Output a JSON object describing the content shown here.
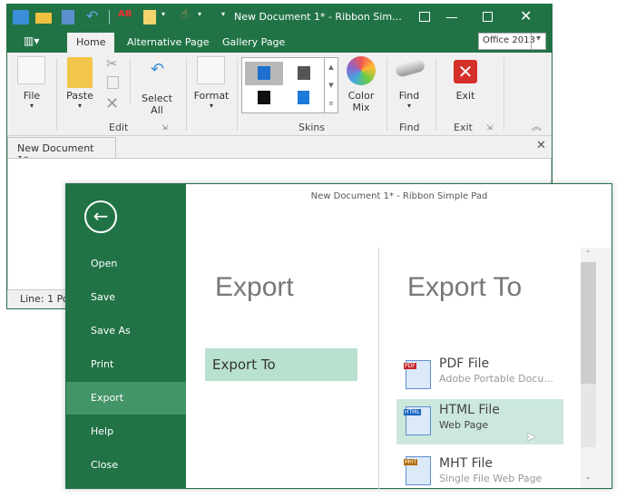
{
  "window": {
    "title": "New Document 1* - Ribbon Simple Pad",
    "title_short": "New Document 1* - Ribbon Sim…"
  },
  "tabs": [
    {
      "label": "Home",
      "active": true
    },
    {
      "label": "Alternative Page"
    },
    {
      "label": "Gallery Page"
    }
  ],
  "skin_select": {
    "value": "Office 2013"
  },
  "ribbon": {
    "file": "File",
    "paste": "Paste",
    "select_all": "Select All",
    "format": "Format",
    "color_mix_1": "Color",
    "color_mix_2": "Mix",
    "find": "Find",
    "exit": "Exit",
    "groups": {
      "edit": "Edit",
      "skins": "Skins",
      "find": "Find",
      "exit": "Exit"
    }
  },
  "document": {
    "tab": "New Document 1*",
    "status": "Line: 1  Po"
  },
  "backstage": {
    "title": "New Document 1* - Ribbon Simple Pad",
    "menu": [
      "Open",
      "Save",
      "Save As",
      "Print",
      "Export",
      "Help",
      "Close"
    ],
    "selected": "Export",
    "heading": "Export",
    "export_to_button": "Export To",
    "right_heading": "Export To",
    "items": [
      {
        "title": "PDF  File",
        "subtitle": "Adobe Portable Docu...",
        "badge": "PDF",
        "badge_color": "#c62828"
      },
      {
        "title": "HTML File",
        "subtitle": "Web Page",
        "badge": "HTML",
        "badge_color": "#1565c0",
        "highlighted": true
      },
      {
        "title": "MHT File",
        "subtitle": "Single File Web Page",
        "badge": "MHT",
        "badge_color": "#b36b00"
      }
    ]
  },
  "colors": {
    "accent": "#217346",
    "menu_selected": "#439467",
    "highlight": "#cce8dc"
  }
}
